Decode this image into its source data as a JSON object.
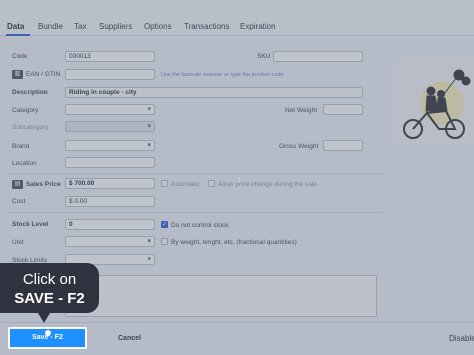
{
  "tabs": [
    {
      "label": "Data"
    },
    {
      "label": "Bundle"
    },
    {
      "label": "Tax"
    },
    {
      "label": "Suppliers"
    },
    {
      "label": "Options"
    },
    {
      "label": "Transactions"
    },
    {
      "label": "Expiration"
    }
  ],
  "form": {
    "code_label": "Code",
    "code_value": "000013",
    "sku_label": "SKU",
    "ean_label": "EAN / GTIN",
    "ean_hint": "Use the barcode scanner or type the product code",
    "description_label": "Description",
    "description_value": "Riding in couple - city",
    "category_label": "Category",
    "net_weight_label": "Net Weight",
    "subcategory_label": "Subcategory",
    "brand_label": "Brand",
    "gross_weight_label": "Gross Weight",
    "location_label": "Location",
    "sales_price_label": "Sales Price",
    "sales_price_value": "$ 700.00",
    "automatic_label": "Automatic",
    "allow_price_change_label": "Allow price change during the sale",
    "cost_label": "Cost",
    "cost_value": "$ 0.00",
    "stock_level_label": "Stock Level",
    "stock_level_value": "0",
    "do_not_control_stock_label": "Do not control stock",
    "unit_label": "Unit",
    "fractional_label": "By weight, lenght, etc. (fractional quantities)",
    "stock_limits_label": "Stock Limits"
  },
  "footer": {
    "save_label": "Save - F2",
    "cancel_label": "Cancel",
    "disable_label": "Disable"
  },
  "tooltip": {
    "line1": "Click on",
    "line2": "SAVE - F2"
  },
  "cursor_glyph": "t",
  "colors": {
    "accent": "#2a5bd7",
    "save_button": "#1e90ff",
    "tooltip_bg": "#2f3340",
    "illustration_sun": "#f2e8b8"
  }
}
